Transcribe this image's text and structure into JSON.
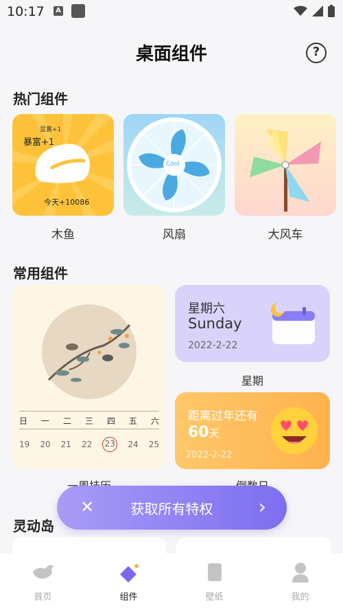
{
  "status_bar": {
    "time": "10:17"
  },
  "header": {
    "title": "桌面组件",
    "help_icon": "?"
  },
  "sections": {
    "hot": {
      "title": "热门组件"
    },
    "common": {
      "title": "常用组件"
    },
    "dynamic": {
      "title": "灵动岛"
    }
  },
  "hot_widgets": {
    "muyu": {
      "label": "木鱼",
      "small_text": "显富+1",
      "big_text": "暴富+1",
      "today_text": "今天+10086"
    },
    "fan": {
      "label": "风扇",
      "center_text": "Cool"
    },
    "windmill": {
      "label": "大风车"
    }
  },
  "calendar_widget": {
    "label": "一周挂历",
    "weekdays": [
      "日",
      "一",
      "二",
      "三",
      "四",
      "五",
      "六"
    ],
    "dates": [
      "19",
      "20",
      "21",
      "22",
      "23",
      "24",
      "25"
    ],
    "today": "23"
  },
  "week_widget": {
    "label": "星期",
    "day_cn": "星期六",
    "day_en": "Sunday",
    "date": "2022-2-22"
  },
  "countdown_widget": {
    "label": "倒数日",
    "title": "距离过年还有",
    "days": "60",
    "days_unit": "天",
    "date": "2022-2-22"
  },
  "privilege_bar": {
    "text": "获取所有特权",
    "close_icon": "close-icon",
    "arrow_icon": "chevron-right-icon",
    "accent": "#7c6ef0"
  },
  "tabbar": {
    "items": [
      {
        "label": "首页",
        "icon": "bird-icon"
      },
      {
        "label": "组件",
        "icon": "widget-icon",
        "active": true
      },
      {
        "label": "壁纸",
        "icon": "wallpaper-icon"
      },
      {
        "label": "我的",
        "icon": "person-icon"
      }
    ]
  }
}
